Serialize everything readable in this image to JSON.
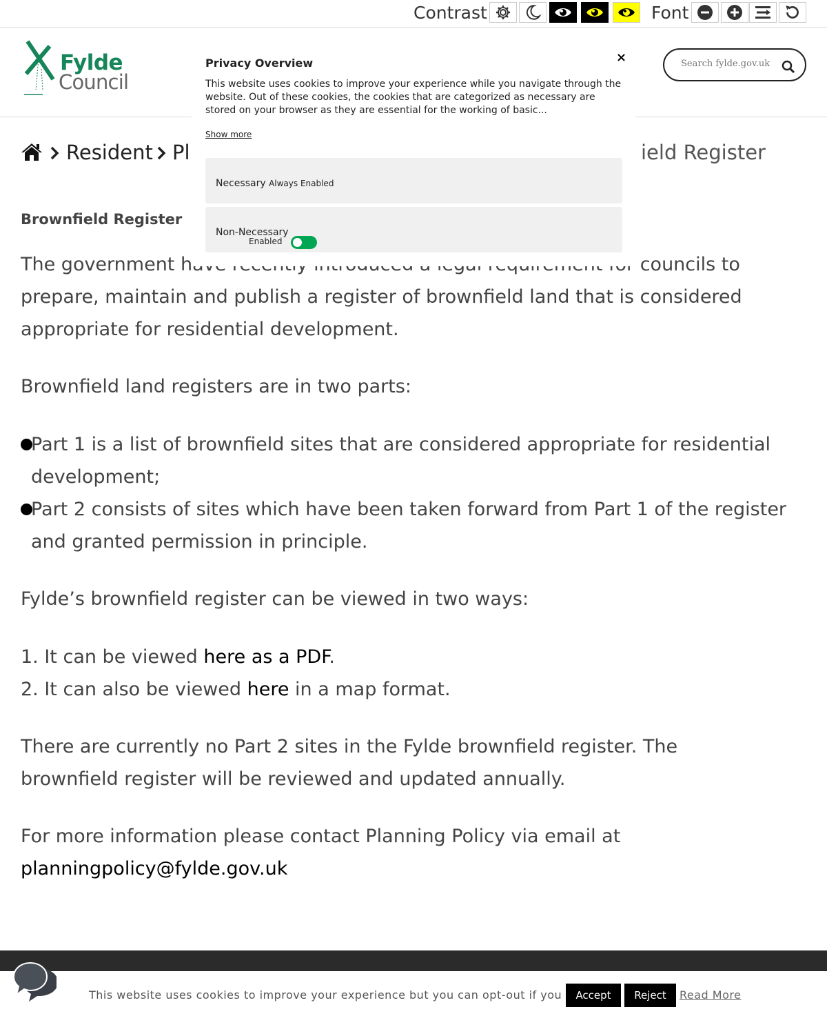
{
  "access_bar": {
    "contrast_label": "Contrast",
    "font_label": "Font"
  },
  "header": {
    "logo_line1": "Fylde",
    "logo_line2": "Council",
    "search_placeholder": "Search fylde.gov.uk"
  },
  "breadcrumb": {
    "item1": "Resident",
    "item2": "Pl",
    "current_partial": "ield Register"
  },
  "main": {
    "page_title": "Brownfield Register",
    "intro": "The government have recently introduced a legal requirement for councils to prepare, maintain and publish a register of brownfield land that is considered appropriate for residential development.",
    "parts_intro": "Brownfield land registers are in two parts:",
    "bullets": [
      "Part 1 is a list of brownfield sites that are considered appropriate for residential development;",
      "Part 2 consists of sites which have been taken forward from Part 1 of the register and granted permission in principle."
    ],
    "ways_intro": "Fylde’s brownfield register can be viewed in two ways:",
    "way1_prefix": "1. It can be viewed ",
    "way1_link": "here as a PDF",
    "way1_suffix": ".",
    "way2_prefix": "2. It can also be viewed ",
    "way2_link": "here",
    "way2_suffix": " in a map format.",
    "part2_note": "There are currently no Part 2 sites in the Fylde brownfield register. The brownfield register will be reviewed and updated annually.",
    "contact_prefix": "For more information please contact Planning Policy via email at ",
    "contact_email": "planningpolicy@fylde.gov.uk"
  },
  "privacy_modal": {
    "title": "Privacy Overview",
    "close": "×",
    "text": "This website uses cookies to improve your experience while you navigate through the website. Out of these cookies, the cookies that are categorized as necessary are stored on your browser as they are essential for the working of basic...",
    "show_more": "Show more",
    "necessary_label": "Necessary",
    "necessary_status": "Always Enabled",
    "non_necessary_label": "Non-Necessary",
    "non_necessary_status": "Enabled",
    "non_necessary_enabled": true
  },
  "cookie_bar": {
    "text": "This website uses cookies to improve your experience but you can opt-out if you wish.",
    "accept": "Accept",
    "reject": "Reject",
    "read_more": "Read More"
  },
  "colors": {
    "brand_green": "#16855a",
    "toggle_on": "#00a651",
    "footer": "#2b2b2b",
    "high_contrast_yellow": "#ffff00"
  },
  "icons": [
    "gear-icon",
    "moon-icon",
    "eye-icon",
    "minus-icon",
    "plus-icon",
    "line-height-icon",
    "reset-icon",
    "home-icon",
    "chevron-right-icon",
    "search-icon",
    "close-icon",
    "chat-icon",
    "windmill-logo"
  ]
}
